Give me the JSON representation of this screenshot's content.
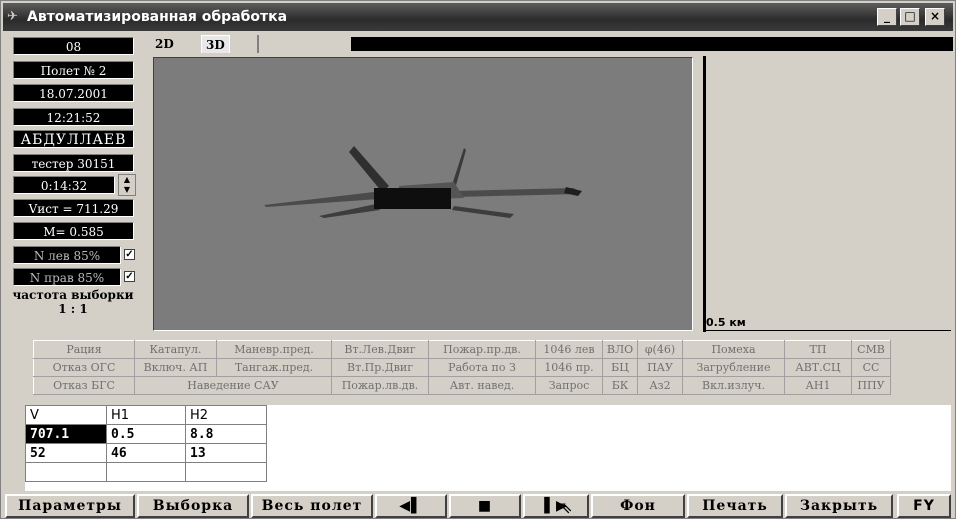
{
  "window": {
    "title": "Автоматизированная обработка",
    "min": "_",
    "max": "□",
    "close": "×"
  },
  "sidebar": {
    "code": "08",
    "flight": "Полет № 2",
    "date": "18.07.2001",
    "time": "12:21:52",
    "pilot": "АБДУЛЛАЕВ",
    "tester": "тестер 30151",
    "elapsed": "0:14:32",
    "vist": "Vист = 711.29",
    "mach": "M= 0.585",
    "n_left": "N лев 85%",
    "n_right": "N прав 85%",
    "freq_label": "частота выборки",
    "freq_value": "1 : 1"
  },
  "tabs": [
    "2D",
    "3D"
  ],
  "view": {
    "scale_label": "0.5 км"
  },
  "status_rows": [
    [
      "Рация",
      "Катапул.",
      "Маневр.пред.",
      "Вт.Лев.Двиг",
      "Пожар.пр.дв.",
      "1046 лев",
      "ВЛО",
      "φ(46)",
      "Помеха",
      "ТП",
      "СМВ"
    ],
    [
      "Отказ ОГС",
      "Включ. АП",
      "Тангаж.пред.",
      "Вт.Пр.Двиг",
      "Работа по З",
      "1046 пр.",
      "БЦ",
      "ПАУ",
      "Загрубление",
      "АВТ.СЦ",
      "СС"
    ],
    [
      "Отказ БГС",
      "Наведение САУ",
      "Пожар.лв.дв.",
      "Авт. навед.",
      "Запрос",
      "БК",
      "Аз2",
      "Вкл.излуч.",
      "АН1",
      "ППУ"
    ]
  ],
  "grid": {
    "headers": [
      "V",
      "H1",
      "H2"
    ],
    "rows": [
      [
        "707.1",
        "0.5",
        "8.8"
      ],
      [
        "52",
        "46",
        "13"
      ]
    ]
  },
  "buttons": {
    "params": "Параметры",
    "sample": "Выборка",
    "whole": "Весь полет",
    "prev": "◀▌",
    "stop": "■",
    "next": "▌▶",
    "bg": "Фон",
    "print": "Печать",
    "close": "Закрыть",
    "fy": "FY"
  }
}
